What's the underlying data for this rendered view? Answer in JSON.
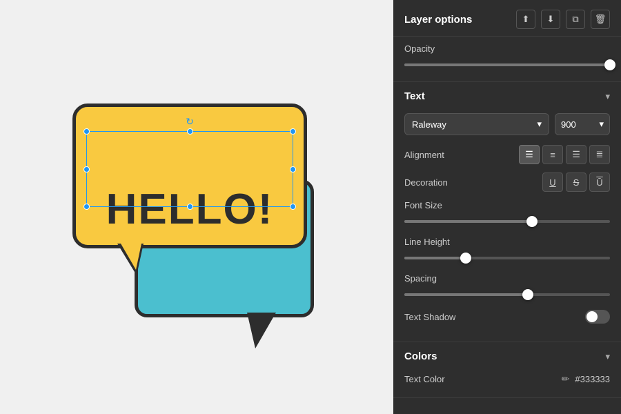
{
  "panel": {
    "layer_options": {
      "title": "Layer options",
      "icons": [
        "align-top",
        "align-bottom",
        "copy",
        "delete"
      ]
    },
    "opacity": {
      "label": "Opacity",
      "value": 100,
      "percent": 100
    },
    "text_section": {
      "title": "Text",
      "font_family": "Raleway",
      "font_weight": "900",
      "alignment": {
        "label": "Alignment",
        "options": [
          "align-left",
          "align-center",
          "align-right",
          "justify"
        ],
        "active": 0
      },
      "decoration": {
        "label": "Decoration",
        "options": [
          "underline",
          "strikethrough",
          "overline"
        ]
      },
      "font_size": {
        "label": "Font Size",
        "value": 65,
        "percent": 62
      },
      "line_height": {
        "label": "Line Height",
        "value": 1.2,
        "percent": 30
      },
      "spacing": {
        "label": "Spacing",
        "value": 0,
        "percent": 60
      },
      "text_shadow": {
        "label": "Text Shadow",
        "enabled": false
      }
    },
    "colors_section": {
      "title": "Colors",
      "text_color": {
        "label": "Text Color",
        "value": "#333333",
        "hex": "#333333"
      }
    }
  },
  "canvas": {
    "hello_text": "HELLO!"
  }
}
